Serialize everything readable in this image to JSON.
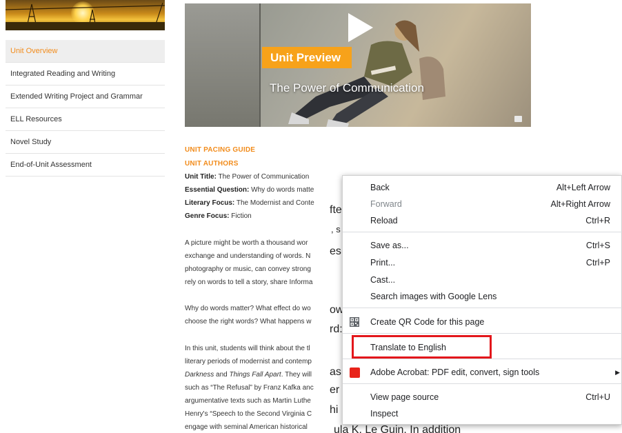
{
  "sidebar": {
    "items": [
      {
        "label": "Unit Overview",
        "active": true
      },
      {
        "label": "Integrated Reading and Writing"
      },
      {
        "label": "Extended Writing Project and Grammar"
      },
      {
        "label": "ELL Resources"
      },
      {
        "label": "Novel Study"
      },
      {
        "label": "End-of-Unit Assessment"
      }
    ]
  },
  "video": {
    "badge": "Unit Preview",
    "title": "The Power of Communication",
    "icon": "play-icon"
  },
  "main": {
    "pacing_guide": "UNIT PACING GUIDE",
    "authors": "UNIT AUTHORS",
    "unit_title_label": "Unit Title:",
    "unit_title_value": " The Power of Communication",
    "essential_question_label": "Essential Question:",
    "essential_question_value": " Why do words matte",
    "literary_focus_label": "Literary Focus:",
    "literary_focus_value": " The Modernist and Conte",
    "genre_focus_label": "Genre Focus:",
    "genre_focus_value": " Fiction",
    "p1": [
      "A picture might be worth a thousand wor",
      "exchange and understanding of words. N",
      "photography or music, can convey strong",
      "rely on words to tell a story, share Informa"
    ],
    "p2": [
      "Why do words matter? What effect do wo",
      "choose the right words? What happens w"
    ],
    "p3_1": "In this unit, students will think about the tl",
    "p3_2": "literary periods of modernist and contemp",
    "p3_3_a": "Darkness",
    "p3_3_b": " and ",
    "p3_3_c": "Things Fall Apart",
    "p3_3_d": ". They will",
    "p3_4": "such as “The Refusal” by Franz Kafka anc",
    "p3_5": "argumentative texts such as Martin Luthe",
    "p3_6": "Henry's “Speech to the Second Virginia C",
    "p3_7": "engage with seminal American historical"
  },
  "fragments": {
    "f1": "fte",
    "f2": ", s",
    "f3": "es,",
    "f4": "ow",
    "f5": "rd:",
    "f6": "as",
    "f7": "er",
    "f8": "hi",
    "f9": "ula K. Le Guin. In addition"
  },
  "context_menu": {
    "back": {
      "label": "Back",
      "shortcut": "Alt+Left Arrow"
    },
    "forward": {
      "label": "Forward",
      "shortcut": "Alt+Right Arrow"
    },
    "reload": {
      "label": "Reload",
      "shortcut": "Ctrl+R"
    },
    "save_as": {
      "label": "Save as...",
      "shortcut": "Ctrl+S"
    },
    "print": {
      "label": "Print...",
      "shortcut": "Ctrl+P"
    },
    "cast": {
      "label": "Cast..."
    },
    "search_lens": {
      "label": "Search images with Google Lens"
    },
    "qr": {
      "label": "Create QR Code for this page"
    },
    "translate": {
      "label": "Translate to English"
    },
    "acrobat": {
      "label": "Adobe Acrobat: PDF edit, convert, sign tools"
    },
    "view_source": {
      "label": "View page source",
      "shortcut": "Ctrl+U"
    },
    "inspect": {
      "label": "Inspect"
    }
  },
  "colors": {
    "accent_orange": "#f28c1c",
    "badge_orange": "#f7a21a",
    "highlight_red": "#e3161b"
  }
}
